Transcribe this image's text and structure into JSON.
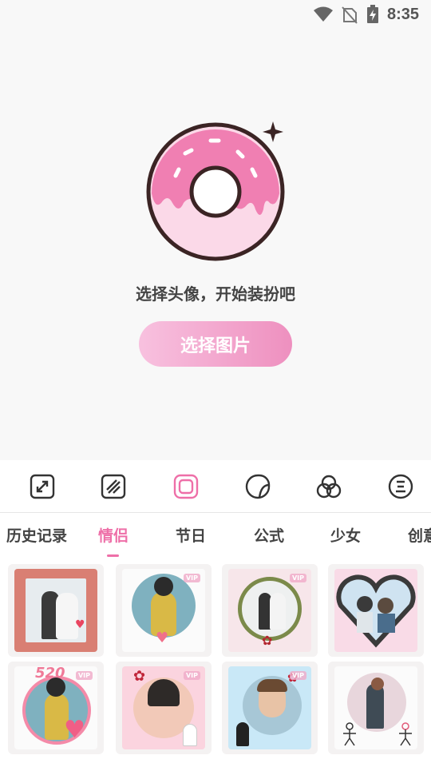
{
  "status_bar": {
    "time": "8:35"
  },
  "hero": {
    "tagline": "选择头像，开始装扮吧",
    "button_label": "选择图片"
  },
  "tools": [
    {
      "name": "crop-expand",
      "icon": "expand-arrows-icon"
    },
    {
      "name": "pattern",
      "icon": "diagonal-lines-icon"
    },
    {
      "name": "frame",
      "icon": "rounded-square-icon",
      "active": true
    },
    {
      "name": "sticker",
      "icon": "sticker-icon"
    },
    {
      "name": "blend",
      "icon": "three-circles-icon"
    },
    {
      "name": "text",
      "icon": "text-circle-icon"
    }
  ],
  "tabs": [
    {
      "label": "历史记录"
    },
    {
      "label": "情侣",
      "active": true
    },
    {
      "label": "节日"
    },
    {
      "label": "公式"
    },
    {
      "label": "少女"
    },
    {
      "label": "创意"
    }
  ],
  "templates": [
    {
      "name": "red-square-frame",
      "vip": false
    },
    {
      "name": "heart-hands-circle",
      "vip": true
    },
    {
      "name": "floral-wreath",
      "vip": true
    },
    {
      "name": "filmstrip-heart",
      "vip": false
    },
    {
      "name": "520-heart-balloons",
      "vip": true
    },
    {
      "name": "rose-couple",
      "vip": true
    },
    {
      "name": "blue-rose-circle",
      "vip": true
    },
    {
      "name": "stick-figure-couple",
      "vip": false
    }
  ],
  "vip_label": "VIP",
  "colors": {
    "accent": "#ee6fa8",
    "button_start": "#f8c1df",
    "button_end": "#ee90bf"
  }
}
